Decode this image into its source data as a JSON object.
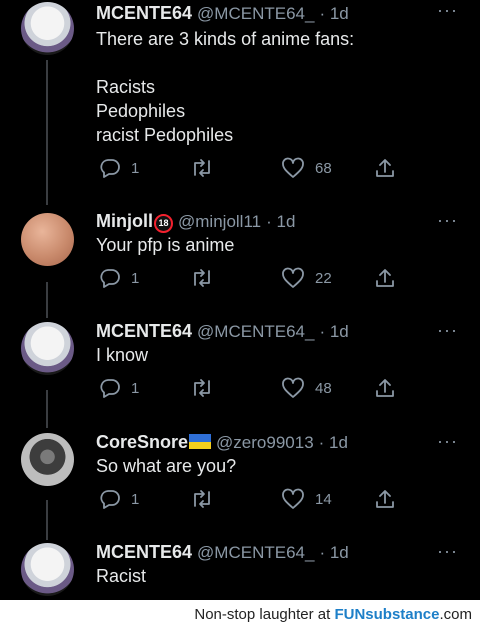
{
  "tweets": [
    {
      "name": "MCENTE64",
      "handle": "@MCENTE64_",
      "time": "· 1d",
      "text": "There are 3 kinds of anime fans:\n\nRacists\nPedophiles\nracist Pedophiles",
      "replies": "1",
      "likes": "68"
    },
    {
      "name": "Minjoll",
      "badge": "18",
      "handle": "@minjoll11",
      "time": "· 1d",
      "text": "Your pfp is anime",
      "replies": "1",
      "likes": "22"
    },
    {
      "name": "MCENTE64",
      "handle": "@MCENTE64_",
      "time": "· 1d",
      "text": "I know",
      "replies": "1",
      "likes": "48"
    },
    {
      "name": "CoreSnore",
      "handle": "@zero99013",
      "time": "· 1d",
      "text": "So what are you?",
      "replies": "1",
      "likes": "14"
    },
    {
      "name": "MCENTE64",
      "handle": "@MCENTE64_",
      "time": "· 1d",
      "text": "Racist"
    }
  ],
  "more_glyph": "···",
  "footer": {
    "prefix": "Non-stop laughter at ",
    "brand": "FUNsubstance",
    "suffix": ".com"
  },
  "colors": {
    "background": "#000000",
    "text": "#e7e9ea",
    "secondary": "#8b98a5",
    "badge_red": "#f4212e",
    "flag_blue": "#2f6fd6",
    "flag_yellow": "#f5cf1c",
    "brand_blue": "#1d7fc8"
  },
  "icons": {
    "reply": "reply-icon",
    "retweet": "retweet-icon",
    "like": "heart-icon",
    "share": "share-icon",
    "more": "more-icon"
  }
}
